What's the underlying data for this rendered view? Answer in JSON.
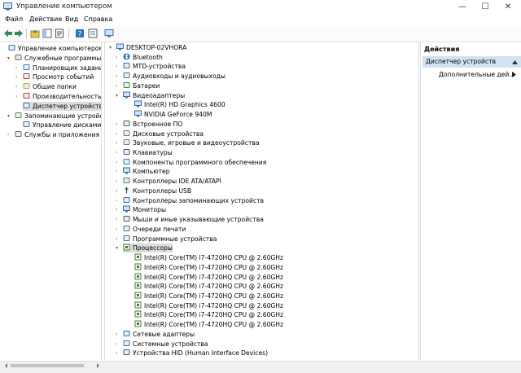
{
  "window": {
    "title": "Управление компьютером",
    "controls": {
      "minimize": "—",
      "maximize": "☐",
      "close": "✕"
    }
  },
  "menu": [
    "Файл",
    "Действие",
    "Вид",
    "Справка"
  ],
  "left_tree": [
    {
      "label": "Управление компьютером (л",
      "level": 0,
      "icon": "computer-management-icon"
    },
    {
      "label": "Служебные программы",
      "level": 1,
      "icon": "tools-icon",
      "expanded": true
    },
    {
      "label": "Планировщик заданий",
      "level": 2,
      "icon": "clock-icon"
    },
    {
      "label": "Просмотр событий",
      "level": 2,
      "icon": "event-viewer-icon"
    },
    {
      "label": "Общие папки",
      "level": 2,
      "icon": "shared-folder-icon"
    },
    {
      "label": "Производительность",
      "level": 2,
      "icon": "performance-icon"
    },
    {
      "label": "Диспетчер устройств",
      "level": 2,
      "icon": "device-manager-icon",
      "selected": true
    },
    {
      "label": "Запоминающие устройства",
      "level": 1,
      "icon": "storage-icon",
      "expanded": true
    },
    {
      "label": "Управление дисками",
      "level": 2,
      "icon": "disk-icon"
    },
    {
      "label": "Службы и приложения",
      "level": 1,
      "icon": "services-icon"
    }
  ],
  "device_tree": {
    "root": "DESKTOP-02VHORA",
    "categories": [
      {
        "label": "Bluetooth",
        "icon": "bluetooth-icon"
      },
      {
        "label": "MTD-устройства",
        "icon": "mtd-icon"
      },
      {
        "label": "Аудиовходы и аудиовыходы",
        "icon": "audio-icon"
      },
      {
        "label": "Батареи",
        "icon": "battery-icon"
      },
      {
        "label": "Видеоадаптеры",
        "icon": "display-adapter-icon",
        "expanded": true,
        "children": [
          "Intel(R) HD Graphics 4600",
          "NVIDIA GeForce 940M"
        ]
      },
      {
        "label": "Встроенное ПО",
        "icon": "firmware-icon"
      },
      {
        "label": "Дисковые устройства",
        "icon": "disk-drive-icon"
      },
      {
        "label": "Звуковые, игровые и видеоустройства",
        "icon": "sound-icon"
      },
      {
        "label": "Клавиатуры",
        "icon": "keyboard-icon"
      },
      {
        "label": "Компоненты программного обеспечения",
        "icon": "software-component-icon"
      },
      {
        "label": "Компьютер",
        "icon": "computer-icon"
      },
      {
        "label": "Контроллеры IDE ATA/ATAPI",
        "icon": "ide-icon"
      },
      {
        "label": "Контроллеры USB",
        "icon": "usb-icon"
      },
      {
        "label": "Контроллеры запоминающих устройств",
        "icon": "storage-controller-icon"
      },
      {
        "label": "Мониторы",
        "icon": "monitor-icon"
      },
      {
        "label": "Мыши и иные указывающие устройства",
        "icon": "mouse-icon"
      },
      {
        "label": "Очереди печати",
        "icon": "printer-icon"
      },
      {
        "label": "Программные устройства",
        "icon": "software-device-icon"
      },
      {
        "label": "Процессоры",
        "icon": "processor-icon",
        "expanded": true,
        "selected": true,
        "children": [
          "Intel(R) Core(TM) i7-4720HQ CPU @ 2.60GHz",
          "Intel(R) Core(TM) i7-4720HQ CPU @ 2.60GHz",
          "Intel(R) Core(TM) i7-4720HQ CPU @ 2.60GHz",
          "Intel(R) Core(TM) i7-4720HQ CPU @ 2.60GHz",
          "Intel(R) Core(TM) i7-4720HQ CPU @ 2.60GHz",
          "Intel(R) Core(TM) i7-4720HQ CPU @ 2.60GHz",
          "Intel(R) Core(TM) i7-4720HQ CPU @ 2.60GHz",
          "Intel(R) Core(TM) i7-4720HQ CPU @ 2.60GHz"
        ]
      },
      {
        "label": "Сетевые адаптеры",
        "icon": "network-adapter-icon"
      },
      {
        "label": "Системные устройства",
        "icon": "system-device-icon"
      },
      {
        "label": "Устройства HID (Human Interface Devices)",
        "icon": "hid-icon"
      }
    ]
  },
  "actions": {
    "title": "Действия",
    "section": "Диспетчер устройств",
    "item": "Дополнительные дей..."
  },
  "colors": {
    "selection": "#dcdcdc",
    "actions_header": "#d1e3f3",
    "accent": "#1e6fbf"
  }
}
